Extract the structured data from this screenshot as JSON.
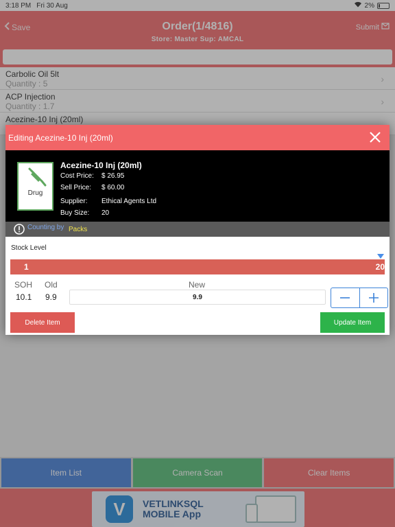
{
  "status_bar": {
    "time": "3:18 PM",
    "date": "Fri 30 Aug",
    "battery": "2%"
  },
  "nav": {
    "back_label": "Save",
    "title": "Order(1/4816)",
    "subtitle": "Store: Master  Sup: AMCAL",
    "submit_label": "Submit"
  },
  "list": {
    "items": [
      {
        "name": "Carbolic Oil 5lt",
        "qty": "Quantity : 5"
      },
      {
        "name": "ACP Injection",
        "qty": "Quantity : 1.7"
      },
      {
        "name": "Acezine-10 Inj (20ml)",
        "qty": ""
      }
    ]
  },
  "bottom_buttons": {
    "item_list": "Item List",
    "camera_scan": "Camera Scan",
    "clear_items": "Clear Items"
  },
  "banner": {
    "logo_letter": "V",
    "line1": "VETLINKSQL",
    "line2": "MOBILE App"
  },
  "modal": {
    "title": "Editing Acezine-10 Inj (20ml)",
    "product": {
      "tile_label": "Drug",
      "name": "Acezine-10 Inj (20ml)",
      "cost_price_label": "Cost Price:",
      "cost_price": "$ 26.95",
      "sell_price_label": "Sell Price:",
      "sell_price": "$ 60.00",
      "supplier_label": "Supplier:",
      "supplier": "Ethical Agents Ltd",
      "buy_size_label": "Buy Size:",
      "buy_size": "20"
    },
    "counting_by_label": "Counting by",
    "counting_by_value": "Packs",
    "stock": {
      "label": "Stock Level",
      "min": 1,
      "max": 20,
      "level": 20
    },
    "soh_label": "SOH",
    "soh_value": "10.1",
    "old_label": "Old",
    "old_value": "9.9",
    "new_label": "New",
    "new_value": "9.9",
    "delete_label": "Delete Item",
    "update_label": "Update Item"
  },
  "colors": {
    "accent": "#f16567",
    "stepper": "#3b82d8",
    "update": "#2db34a",
    "delete": "#dd5a55",
    "marker": "#4a8ee8"
  },
  "icons": {
    "close": "close-icon",
    "warning": "warning-icon",
    "drug": "syringe-icon",
    "minus": "minus-icon",
    "plus": "plus-icon",
    "back": "chevron-left-icon",
    "submit": "submit-icon"
  }
}
